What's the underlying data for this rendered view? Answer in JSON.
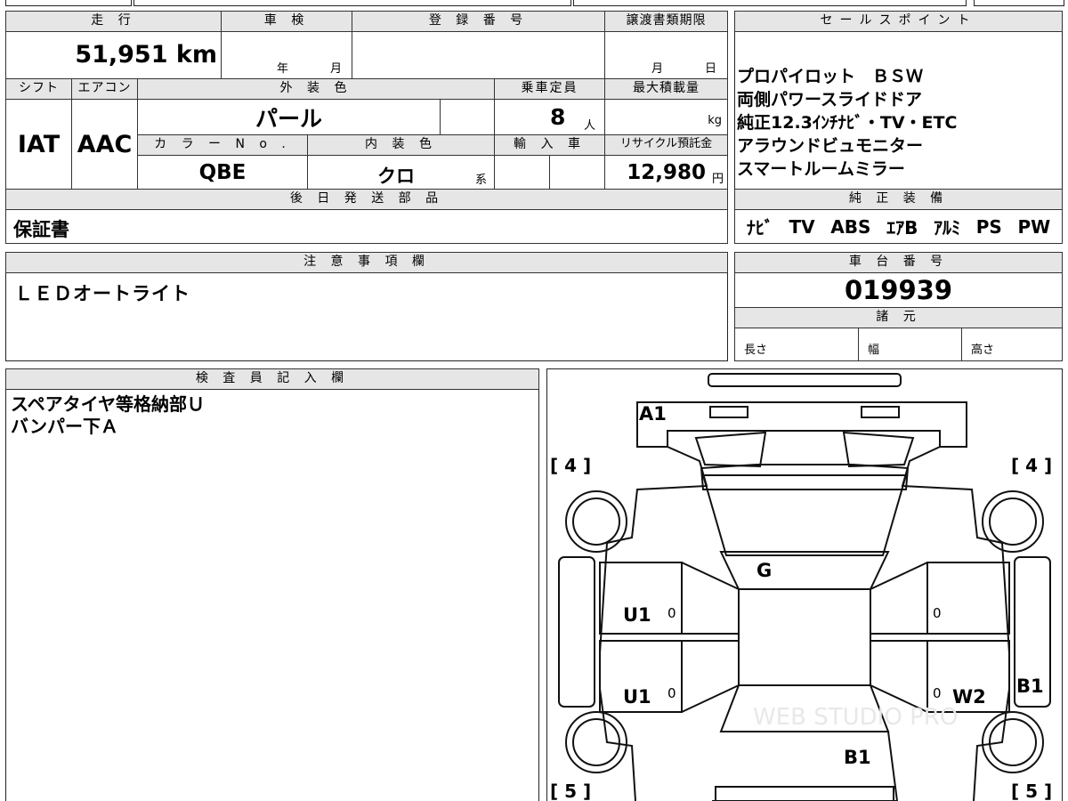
{
  "main_table": {
    "mileage_label": "走 行",
    "mileage_value": "51,951 km",
    "inspection_label": "車 検",
    "inspection_year_unit": "年",
    "inspection_month_unit": "月",
    "registration_label": "登 録 番 号",
    "transfer_docs_label": "譲渡書類期限",
    "transfer_month_unit": "月",
    "transfer_day_unit": "日",
    "shift_label": "シフト",
    "aircon_label": "エアコン",
    "exterior_color_label": "外 装 色",
    "capacity_label": "乗車定員",
    "max_load_label": "最大積載量",
    "shift_value": "IAT",
    "aircon_value": "AAC",
    "exterior_color_value": "パール",
    "capacity_value": "8",
    "capacity_unit": "人",
    "max_load_unit": "kg",
    "color_no_label": "カ ラ ー N o .",
    "interior_color_label": "内 装 色",
    "import_label": "輸 入 車",
    "recycle_label": "リサイクル預託金",
    "color_no_value": "QBE",
    "interior_color_value": "クロ",
    "interior_color_suffix": "系",
    "recycle_value": "12,980",
    "recycle_unit": "円",
    "later_parts_label": "後 日 発 送 部 品",
    "later_parts_value": "保証書"
  },
  "sales_points": {
    "label": "セールスポイント",
    "lines": [
      "プロパイロット　ＢＳＷ",
      "両側パワースライドドア",
      "純正12.3ｲﾝﾁﾅﾋﾞ・TV・ETC",
      "アラウンドビュモニター",
      "スマートルームミラー"
    ]
  },
  "genuine_equipment": {
    "label": "純 正 装 備",
    "items": [
      "ﾅﾋﾞ",
      "TV",
      "ABS",
      "ｴｱB",
      "ｱﾙﾐ",
      "PS",
      "PW"
    ]
  },
  "notes": {
    "label": "注 意 事 項 欄",
    "value": "ＬＥＤオートライト"
  },
  "chassis": {
    "label": "車 台 番 号",
    "value": "019939"
  },
  "specs": {
    "label": "諸 元",
    "length_label": "長さ",
    "width_label": "幅",
    "height_label": "高さ"
  },
  "inspector": {
    "label": "検 査 員 記 入 欄",
    "lines": [
      "スペアタイヤ等格納部Ｕ",
      "バンパー下Ａ"
    ]
  },
  "diagram": {
    "tire_front_left": "[ 4 ]",
    "tire_front_right": "[ 4 ]",
    "tire_rear_left": "[ 5 ]",
    "tire_rear_right": "[ 5 ]",
    "mark_a1": "A1",
    "mark_g": "G",
    "mark_u1_top": "U1",
    "mark_u1_bottom": "U1",
    "mark_w2": "W2",
    "mark_b1_right": "B1",
    "mark_b1_rear": "B1",
    "zero_1": "0",
    "zero_2": "0",
    "zero_3": "0",
    "zero_4": "0",
    "watermark": "WEB STUDIO PRO"
  }
}
